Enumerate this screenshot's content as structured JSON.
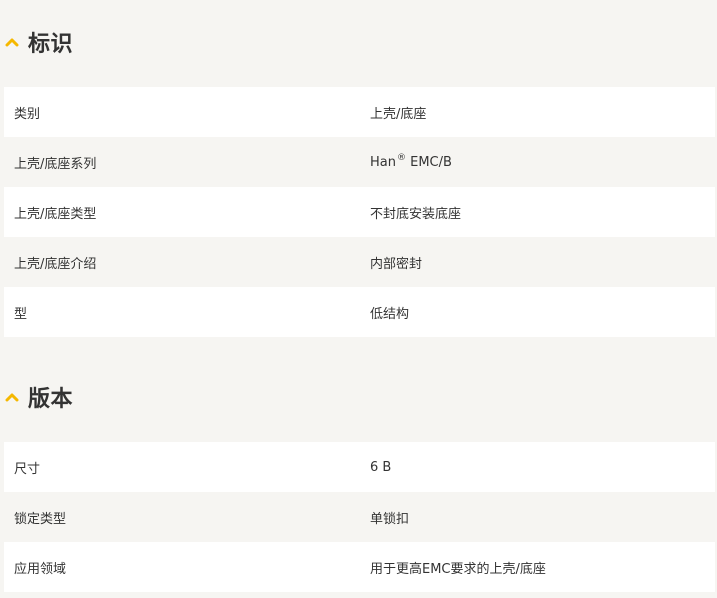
{
  "colors": {
    "accent": "#f5b800",
    "background": "#f6f5f2",
    "row_white": "#ffffff",
    "text": "#333333"
  },
  "sections": [
    {
      "title": "标识",
      "icon": "chevron-up-icon",
      "rows": [
        {
          "label": "类别",
          "value": "上壳/底座"
        },
        {
          "label": "上壳/底座系列",
          "value": "Han",
          "value_sup": "®",
          "value_suffix": " EMC/B"
        },
        {
          "label": "上壳/底座类型",
          "value": "不封底安装底座"
        },
        {
          "label": "上壳/底座介绍",
          "value": "内部密封"
        },
        {
          "label": "型",
          "value": "低结构"
        }
      ]
    },
    {
      "title": "版本",
      "icon": "chevron-up-icon",
      "rows": [
        {
          "label": "尺寸",
          "value": "6 B"
        },
        {
          "label": "锁定类型",
          "value": "单锁扣"
        },
        {
          "label": "应用领域",
          "value": "用于更高EMC要求的上壳/底座"
        }
      ]
    }
  ]
}
